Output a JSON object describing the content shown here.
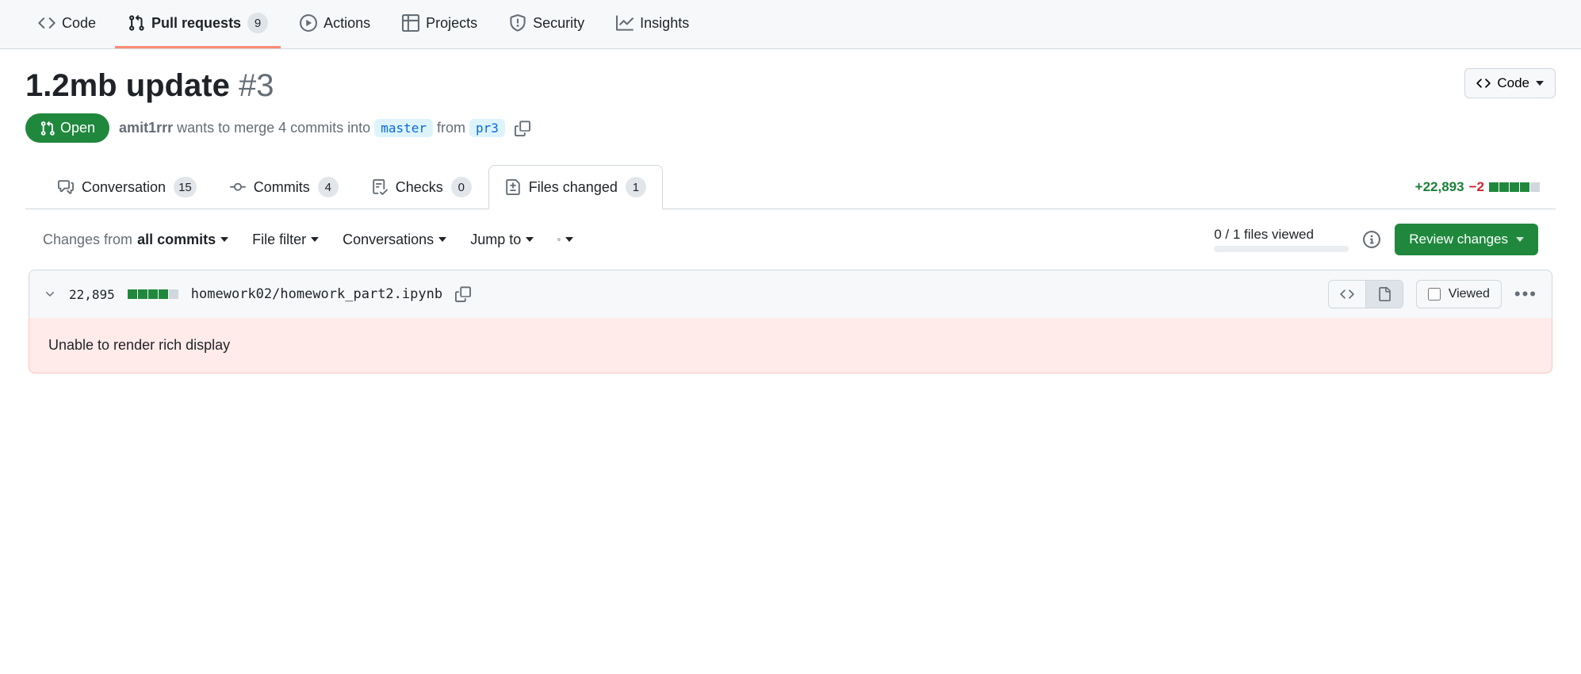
{
  "nav": {
    "code": "Code",
    "pulls": "Pull requests",
    "pulls_count": "9",
    "actions": "Actions",
    "projects": "Projects",
    "security": "Security",
    "insights": "Insights"
  },
  "pr": {
    "title": "1.2mb update",
    "number": "#3",
    "code_button": "Code",
    "state": "Open",
    "author": "amit1rrr",
    "merge_pre": " wants to merge 4 commits into ",
    "base_branch": "master",
    "merge_mid": " from ",
    "head_branch": "pr3"
  },
  "tabs": {
    "conversation": "Conversation",
    "conversation_count": "15",
    "commits": "Commits",
    "commits_count": "4",
    "checks": "Checks",
    "checks_count": "0",
    "files": "Files changed",
    "files_count": "1",
    "diff_add": "+22,893",
    "diff_del": "−2"
  },
  "toolbar": {
    "changes_from": "Changes from",
    "changes_from_value": "all commits",
    "file_filter": "File filter",
    "conversations": "Conversations",
    "jump_to": "Jump to",
    "files_viewed": "0 / 1 files viewed",
    "review": "Review changes"
  },
  "file": {
    "lines": "22,895",
    "path": "homework02/homework_part2.ipynb",
    "viewed_label": "Viewed",
    "error": "Unable to render rich display"
  }
}
